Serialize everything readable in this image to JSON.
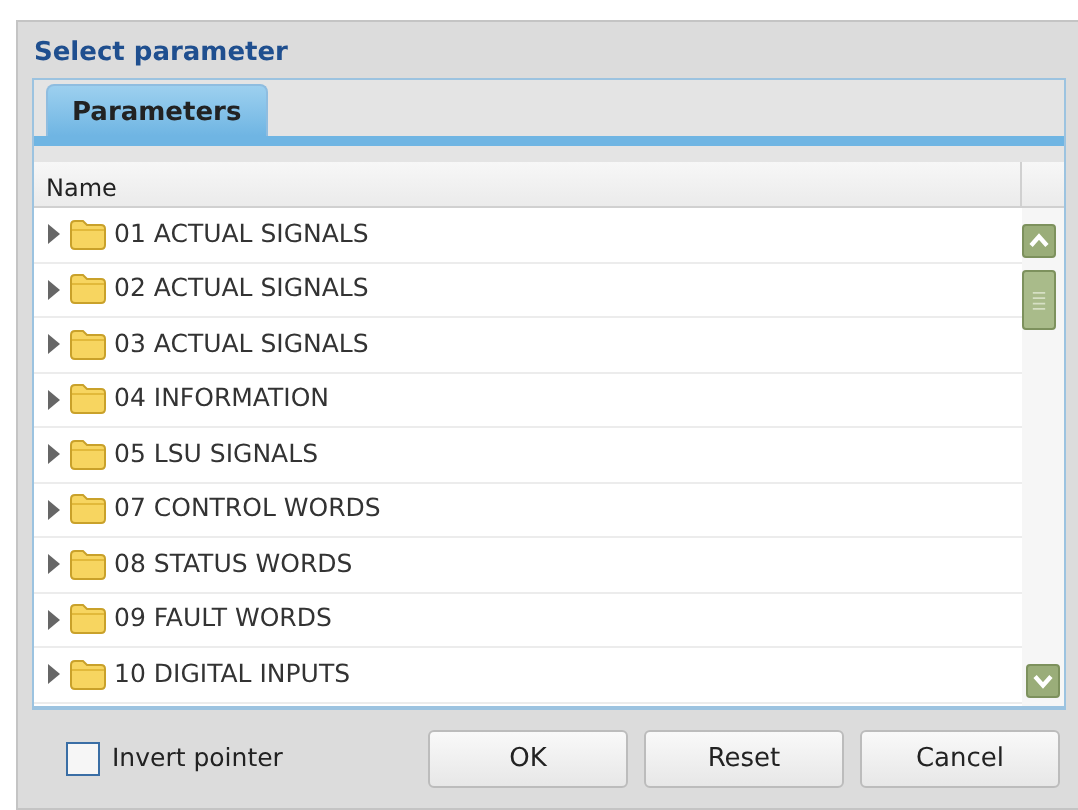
{
  "window": {
    "title": "Select parameter"
  },
  "tabs": [
    {
      "label": "Parameters",
      "selected": true
    }
  ],
  "table": {
    "columns": [
      "Name"
    ],
    "rows": [
      {
        "label": "01 ACTUAL SIGNALS",
        "expanded": false
      },
      {
        "label": "02 ACTUAL SIGNALS",
        "expanded": false
      },
      {
        "label": "03 ACTUAL SIGNALS",
        "expanded": false
      },
      {
        "label": "04 INFORMATION",
        "expanded": false
      },
      {
        "label": "05 LSU SIGNALS",
        "expanded": false
      },
      {
        "label": "07 CONTROL WORDS",
        "expanded": false
      },
      {
        "label": "08 STATUS WORDS",
        "expanded": false
      },
      {
        "label": "09 FAULT WORDS",
        "expanded": false
      },
      {
        "label": "10 DIGITAL INPUTS",
        "expanded": false
      }
    ]
  },
  "invert_pointer": {
    "label": "Invert pointer",
    "checked": false
  },
  "buttons": [
    "OK",
    "Reset",
    "Cancel"
  ]
}
